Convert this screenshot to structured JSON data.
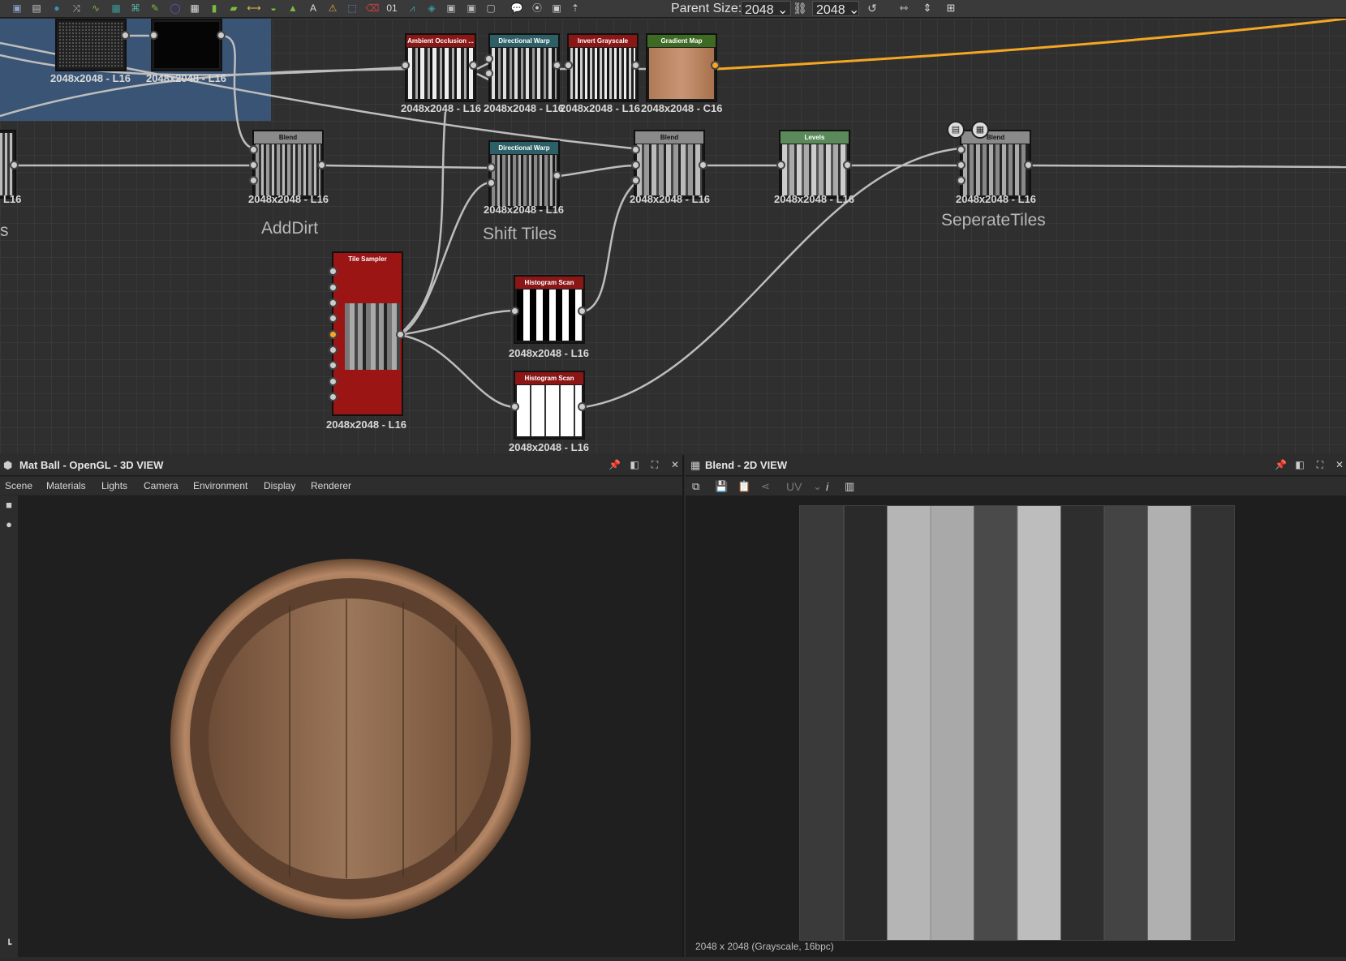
{
  "toolbar": {
    "parent_size_label": "Parent Size:",
    "parent_size_value": "2048",
    "size_value": "2048",
    "icons": [
      "image-icon",
      "document-icon",
      "drop-icon",
      "shuffle-icon",
      "curve-icon",
      "gradient-icon",
      "warp-icon",
      "brush-icon",
      "circle-icon",
      "grid-icon",
      "bucket-icon",
      "fill-icon",
      "slider-icon",
      "sphere-icon",
      "levels-icon",
      "text-icon",
      "triangle-icon",
      "select-icon",
      "eraser-icon",
      "number-icon",
      "uv-icon",
      "tile-icon",
      "frame-icon",
      "frame2-icon",
      "frame3-icon",
      "comment-icon",
      "connect-icon",
      "pin-icon",
      "arrow-icon",
      "link-icon",
      "reset-icon",
      "align-h-icon",
      "align-v-icon",
      "distribute-icon"
    ],
    "colors": {
      "green": "#7dbb3c",
      "teal": "#3a9a9a",
      "purple": "#6a4fcf",
      "orange": "#f5a623"
    }
  },
  "graph": {
    "nodes": {
      "n1": {
        "title": "",
        "size": "2048x2048 - L16"
      },
      "n2": {
        "title": "",
        "size": "2048x2048 - L16"
      },
      "ao": {
        "title": "Ambient Occlusion ...",
        "size": "2048x2048 - L16",
        "color": "#8a1616"
      },
      "dw1": {
        "title": "Directional Warp",
        "size": "2048x2048 - L16",
        "color": "#2c5f66"
      },
      "inv": {
        "title": "Invert Grayscale",
        "size": "2048x2048 - L16",
        "color": "#8a1616"
      },
      "grad": {
        "title": "Gradient Map",
        "size": "2048x2048 - C16",
        "color": "#3d6b23"
      },
      "left": {
        "title": "",
        "size": "L16"
      },
      "blend1": {
        "title": "Blend",
        "size": "2048x2048 - L16",
        "color": "#8a8a8a"
      },
      "dw2": {
        "title": "Directional Warp",
        "size": "2048x2048 - L16",
        "color": "#2c5f66"
      },
      "blend2": {
        "title": "Blend",
        "size": "2048x2048 - L16",
        "color": "#8a8a8a"
      },
      "levels": {
        "title": "Levels",
        "size": "2048x2048 - L16",
        "color": "#5a8a5a"
      },
      "blend3": {
        "title": "Blend",
        "size": "2048x2048 - L16",
        "color": "#8a8a8a"
      },
      "tile": {
        "title": "Tile Sampler",
        "size": "2048x2048 - L16",
        "color": "#9b1515"
      },
      "hist1": {
        "title": "Histogram Scan",
        "size": "2048x2048 - L16",
        "color": "#8a1616"
      },
      "hist2": {
        "title": "Histogram Scan",
        "size": "2048x2048 - L16",
        "color": "#8a1616"
      }
    },
    "frames": {
      "adddirt": "AddDirt",
      "shifttiles": "Shift Tiles",
      "seperatetiles": "SeperateTiles",
      "left_fragment": "s"
    }
  },
  "panel3d": {
    "title": "Mat Ball - OpenGL - 3D VIEW",
    "menu": [
      "Scene",
      "Materials",
      "Lights",
      "Camera",
      "Environment",
      "Display",
      "Renderer"
    ],
    "side_icons": [
      "camera-icon",
      "bulb-icon",
      "hierarchy-icon"
    ]
  },
  "panel2d": {
    "title": "Blend - 2D VIEW",
    "toolbar": [
      "copy-icon",
      "save-icon",
      "paste-icon",
      "share-icon",
      "UV",
      "info-icon",
      "histogram-icon"
    ],
    "status": "2048 x 2048 (Grayscale, 16bpc)"
  }
}
